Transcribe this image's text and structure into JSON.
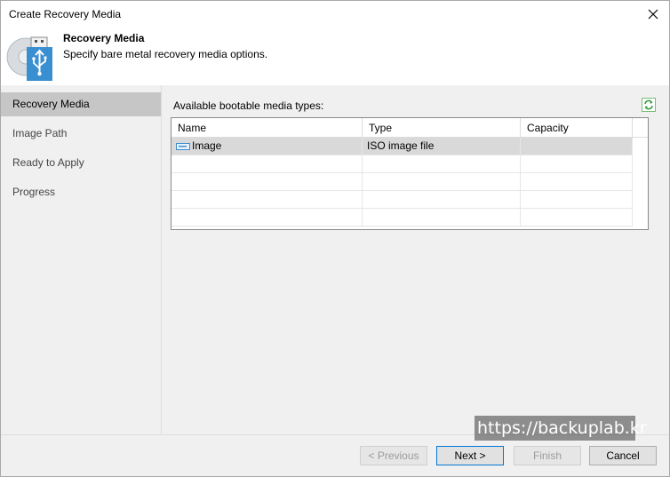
{
  "window": {
    "title": "Create Recovery Media"
  },
  "header": {
    "title": "Recovery Media",
    "subtitle": "Specify bare metal recovery media options."
  },
  "steps": [
    {
      "label": "Recovery Media",
      "active": true
    },
    {
      "label": "Image Path",
      "active": false
    },
    {
      "label": "Ready to Apply",
      "active": false
    },
    {
      "label": "Progress",
      "active": false
    }
  ],
  "content": {
    "available_label": "Available bootable media types:",
    "columns": [
      "Name",
      "Type",
      "Capacity"
    ],
    "rows": [
      {
        "name": "Image",
        "type": "ISO image file",
        "capacity": "",
        "selected": true
      }
    ]
  },
  "footer": {
    "previous": "< Previous",
    "next": "Next >",
    "finish": "Finish",
    "cancel": "Cancel"
  },
  "watermark": "https://backuplab.kr",
  "colors": {
    "accent": "#0078d7",
    "usb_icon": "#3a8fd0",
    "selected_row": "#d9d9d9"
  },
  "icons": {
    "close": "close-icon",
    "usb": "usb-drive-icon",
    "refresh": "refresh-icon",
    "disk": "disk-icon"
  }
}
